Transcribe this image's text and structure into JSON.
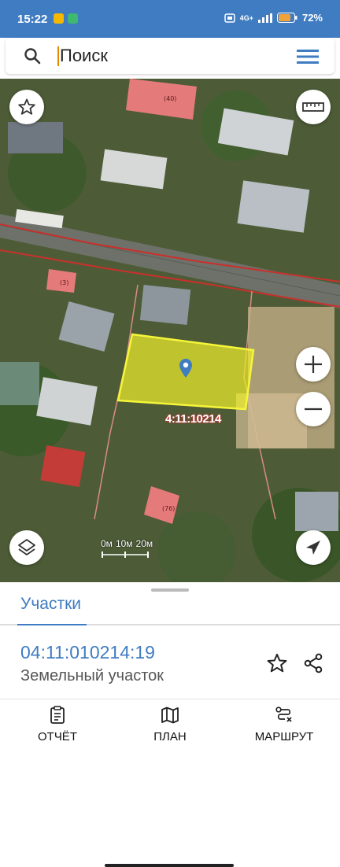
{
  "status": {
    "time": "15:22",
    "network": "4G+",
    "battery": "72%",
    "colors": {
      "bar": "#3f7cc2"
    }
  },
  "search": {
    "placeholder": "Поиск"
  },
  "map": {
    "scale_labels": [
      "0м",
      "10м",
      "20м"
    ],
    "parcel_label": "4:11:10214",
    "building_labels": [
      "(40)",
      "(3)",
      "(76)"
    ],
    "highlight_color": "#f0f02a"
  },
  "sheet": {
    "tab": "Участки",
    "parcel_id": "04:11:010214:19",
    "parcel_type": "Земельный участок"
  },
  "nav": {
    "report": "ОТЧЁТ",
    "plan": "ПЛАН",
    "route": "МАРШРУТ"
  },
  "icons": [
    "search-icon",
    "menu-icon",
    "star-icon",
    "ruler-icon",
    "zoom-in-icon",
    "zoom-out-icon",
    "layers-icon",
    "locate-icon",
    "map-pin-icon",
    "share-icon",
    "report-icon",
    "map-icon",
    "route-icon"
  ]
}
